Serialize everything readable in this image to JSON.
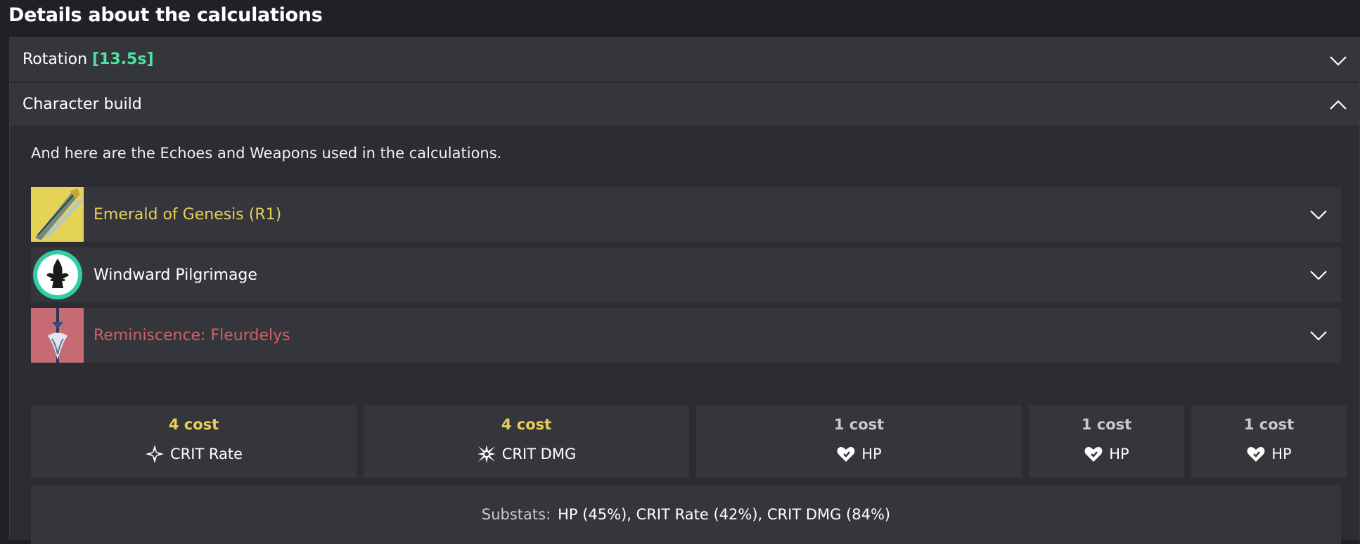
{
  "page": {
    "title": "Details about the calculations"
  },
  "rotation": {
    "label": "Rotation",
    "duration": "[13.5s]"
  },
  "character_build": {
    "label": "Character build",
    "intro": "And here are the Echoes and Weapons used in the calculations."
  },
  "items": [
    {
      "name": "Emerald of Genesis (R1)",
      "color": "#e8cf59",
      "thumb_bg": "#e5d357"
    },
    {
      "name": "Windward Pilgrimage",
      "color": "#ffffff",
      "thumb_bg": "#2c2d32"
    },
    {
      "name": "Reminiscence: Fleurdelys",
      "color": "#d26068",
      "thumb_bg": "#c76a73"
    }
  ],
  "costs": [
    {
      "title": "4 cost",
      "stat": "CRIT Rate",
      "icon": "crit-rate-icon"
    },
    {
      "title": "4 cost",
      "stat": "CRIT DMG",
      "icon": "crit-dmg-icon"
    },
    {
      "title": "1 cost",
      "stat": "HP",
      "icon": "hp-heart-icon"
    },
    {
      "title": "1 cost",
      "stat": "HP",
      "icon": "hp-heart-icon"
    },
    {
      "title": "1 cost",
      "stat": "HP",
      "icon": "hp-heart-icon"
    }
  ],
  "substats": {
    "label": "Substats:",
    "value": "HP (45%), CRIT Rate (42%), CRIT DMG (84%)"
  },
  "colors": {
    "accent_green": "#4fe3a3",
    "gold": "#e8cf59",
    "rose": "#d26068"
  }
}
